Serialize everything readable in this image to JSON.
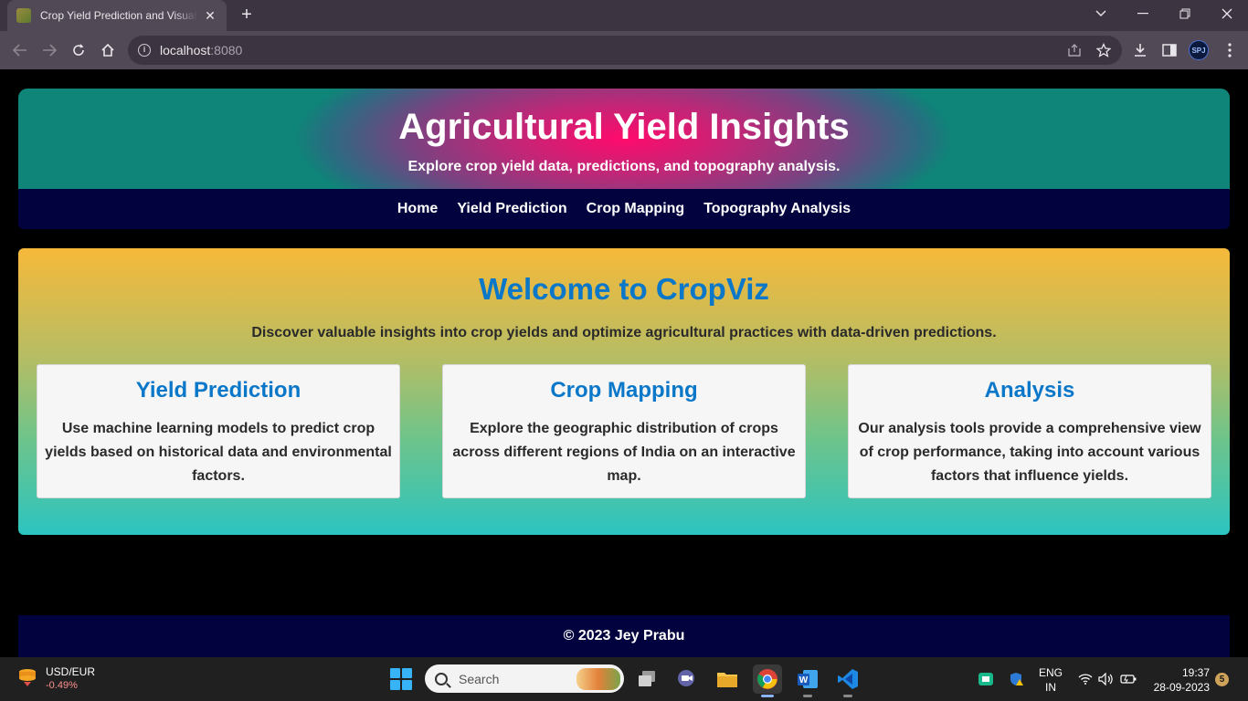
{
  "browser": {
    "tab_title": "Crop Yield Prediction and Visualization",
    "tab_close": "✕",
    "new_tab": "+",
    "url_host": "localhost",
    "url_port": ":8080",
    "profile_initials": "SPJ",
    "icons": [
      "back-icon",
      "forward-icon",
      "reload-icon",
      "home-icon",
      "info-icon",
      "share-icon",
      "star-icon",
      "download-icon",
      "sidepanel-icon",
      "menu-icon"
    ]
  },
  "header": {
    "title": "Agricultural Yield Insights",
    "subtitle": "Explore crop yield data, predictions, and topography analysis."
  },
  "nav": {
    "items": [
      "Home",
      "Yield Prediction",
      "Crop Mapping",
      "Topography Analysis"
    ]
  },
  "welcome": {
    "title": "Welcome to CropViz",
    "description": "Discover valuable insights into crop yields and optimize agricultural practices with data-driven predictions.",
    "cards": [
      {
        "title": "Yield Prediction",
        "text": "Use machine learning models to predict crop yields based on historical data and environmental factors."
      },
      {
        "title": "Crop Mapping",
        "text": "Explore the geographic distribution of crops across different regions of India on an interactive map."
      },
      {
        "title": "Analysis",
        "text": "Our analysis tools provide a comprehensive view of crop performance, taking into account various factors that influence yields."
      }
    ]
  },
  "footer": {
    "text": "© 2023 Jey Prabu"
  },
  "taskbar": {
    "ticker_name": "USD/EUR",
    "ticker_change": "-0.49%",
    "search_placeholder": "Search",
    "lang_line1": "ENG",
    "lang_line2": "IN",
    "time": "19:37",
    "date": "28-09-2023",
    "notification_count": "5",
    "colors": {
      "ticker_negative": "#ff8f8f",
      "windows_blue": "#37b4f7"
    }
  },
  "colors": {
    "accent_blue": "#0a77c9",
    "nav_bg": "#02023f",
    "header_pink": "#ff0a6c",
    "header_teal": "#0f8478"
  }
}
